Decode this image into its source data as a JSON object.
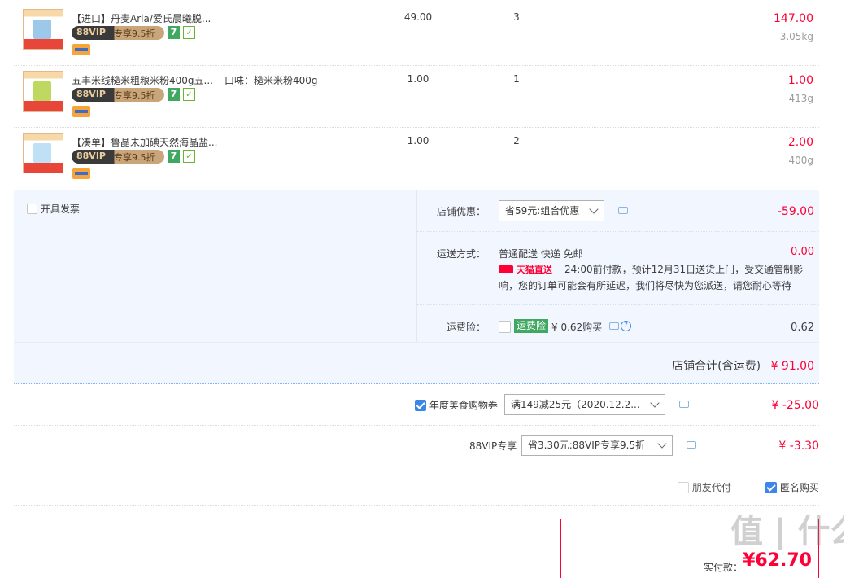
{
  "items": [
    {
      "name": "【进口】丹麦Arla/爱氏晨曦脱...",
      "sku": "",
      "vip_badge_left": "88VIP",
      "vip_badge_right": "专享9.5折",
      "seven_badge": "7",
      "price": "49.00",
      "qty": "3",
      "subtotal": "147.00",
      "weight": "3.05kg"
    },
    {
      "name": "五丰米线糙米粗粮米粉400g五...",
      "sku": "口味：糙米米粉400g",
      "vip_badge_left": "88VIP",
      "vip_badge_right": "专享9.5折",
      "seven_badge": "7",
      "price": "1.00",
      "qty": "1",
      "subtotal": "1.00",
      "weight": "413g"
    },
    {
      "name": "【凑单】鲁晶未加碘天然海晶盐...",
      "sku": "",
      "vip_badge_left": "88VIP",
      "vip_badge_right": "专享9.5折",
      "seven_badge": "7",
      "price": "1.00",
      "qty": "2",
      "subtotal": "2.00",
      "weight": "400g"
    }
  ],
  "invoice": {
    "label": "开具发票",
    "checked": false
  },
  "store_discount": {
    "label": "店铺优惠：",
    "value": "省59元:组合优惠",
    "amount": "-59.00"
  },
  "shipping": {
    "label": "运送方式：",
    "method": "普通配送 快递 免邮",
    "amount": "0.00",
    "tmall_tag": "天猫直送",
    "note_line1": "24:00前付款，预计12月31日送货上门，受交通管制影",
    "note_line2": "响，您的订单可能会有所延迟，我们将尽快为您派送，请您耐心等待"
  },
  "freight_insurance": {
    "label": "运费险：",
    "tag": "运费险",
    "text": "¥ 0.62购买",
    "amount": "0.62",
    "checked": false
  },
  "store_total": {
    "label": "店铺合计(含运费)",
    "amount": "¥ 91.00"
  },
  "coupon": {
    "label": "年度美食购物券",
    "checked": true,
    "value": "满149减25元（2020.12.2...",
    "amount": "¥ -25.00"
  },
  "vip": {
    "label": "88VIP专享",
    "value": "省3.30元:88VIP专享9.5折",
    "amount": "¥ -3.30"
  },
  "friend_pay": {
    "label": "朋友代付",
    "checked": false
  },
  "anonymous": {
    "label": "匿名购买",
    "checked": true
  },
  "pay_box": {
    "label": "实付款：",
    "amount": "¥62.70"
  },
  "watermark": "值 | 什么值得买"
}
